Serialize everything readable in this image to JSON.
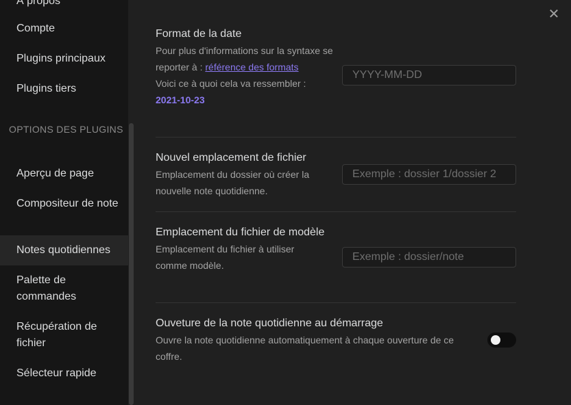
{
  "sidebar": {
    "items_top": [
      {
        "label": "À propos"
      },
      {
        "label": "Compte"
      },
      {
        "label": "Plugins principaux"
      },
      {
        "label": "Plugins tiers"
      }
    ],
    "section_label": "OPTIONS DES PLUGINS",
    "plugin_items": [
      {
        "label": "Aperçu de page",
        "active": false
      },
      {
        "label": "Compositeur de note",
        "active": false
      },
      {
        "label": "Notes quotidiennes",
        "active": true
      },
      {
        "label": "Palette de commandes",
        "active": false
      },
      {
        "label": "Récupération de fichier",
        "active": false
      },
      {
        "label": "Sélecteur rapide",
        "active": false
      }
    ]
  },
  "close_label": "✕",
  "settings": {
    "date_format": {
      "name": "Format de la date",
      "desc_prefix": "Pour plus d'informations sur la syntaxe se reporter à : ",
      "link_text": "référence des formats",
      "preview_label": "Voici ce à quoi cela va ressembler :",
      "preview_value": "2021-10-23",
      "placeholder": "YYYY-MM-DD",
      "value": ""
    },
    "new_file_location": {
      "name": "Nouvel emplacement de fichier",
      "desc": "Emplacement du dossier où créer la nouvelle note quotidienne.",
      "placeholder": "Exemple : dossier 1/dossier 2",
      "value": ""
    },
    "template_location": {
      "name": "Emplacement du fichier de modèle",
      "desc": "Emplacement du fichier à utiliser comme modèle.",
      "placeholder": "Exemple : dossier/note",
      "value": ""
    },
    "open_on_startup": {
      "name": "Ouveture de la note quotidienne au démarrage",
      "desc": "Ouvre la note quotidienne automatiquement à chaque ouverture de ce coffre.",
      "enabled": false
    }
  }
}
